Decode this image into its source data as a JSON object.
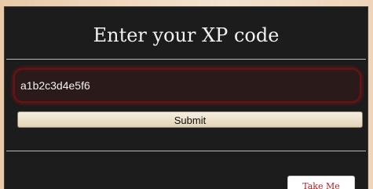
{
  "dialog": {
    "title": "Enter your XP code",
    "input": {
      "value": "a1b2c3d4e5f6",
      "placeholder": ""
    },
    "submit_label": "Submit",
    "back_label": "Take Me back"
  },
  "colors": {
    "modal_background": "#1c1c1c",
    "input_glow": "#6f1010",
    "back_text": "#b0201f"
  }
}
